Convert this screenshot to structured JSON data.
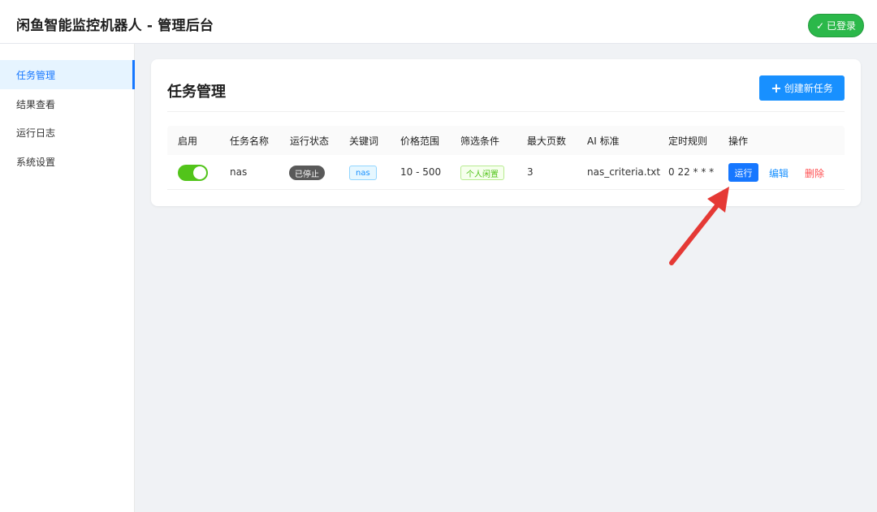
{
  "header": {
    "title": "闲鱼智能监控机器人 - 管理后台",
    "login_badge": "已登录",
    "login_check": "✓"
  },
  "sidebar": {
    "items": [
      {
        "label": "任务管理",
        "active": true
      },
      {
        "label": "结果查看",
        "active": false
      },
      {
        "label": "运行日志",
        "active": false
      },
      {
        "label": "系统设置",
        "active": false
      }
    ]
  },
  "main": {
    "title": "任务管理",
    "create_button": "创建新任务",
    "table": {
      "columns": [
        "启用",
        "任务名称",
        "运行状态",
        "关键词",
        "价格范围",
        "筛选条件",
        "最大页数",
        "AI 标准",
        "定时规则",
        "操作"
      ],
      "rows": [
        {
          "enabled": true,
          "name": "nas",
          "status": "已停止",
          "keyword": "nas",
          "price_range": "10 - 500",
          "filter": "个人闲置",
          "max_pages": "3",
          "ai_standard": "nas_criteria.txt",
          "cron": "0 22 * * *",
          "actions": {
            "run": "运行",
            "edit": "编辑",
            "delete": "删除"
          }
        }
      ]
    }
  },
  "colors": {
    "accent": "#1677ff",
    "success": "#52c41a",
    "danger": "#ff4d4f",
    "annotation_arrow": "#e53935"
  }
}
